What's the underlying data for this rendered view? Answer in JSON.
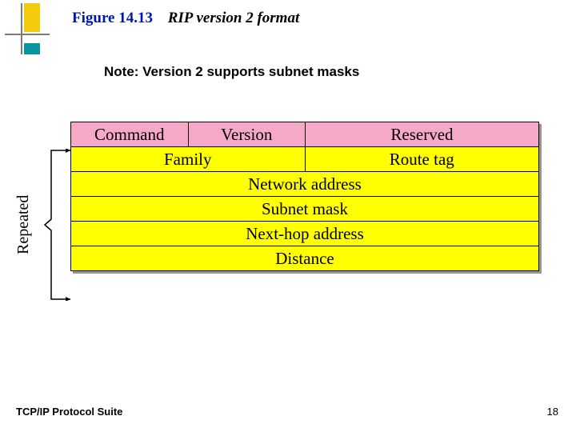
{
  "heading": {
    "figure_number": "Figure 14.13",
    "figure_title": "RIP version 2 format"
  },
  "note": "Note: Version 2 supports subnet masks",
  "repeated_label": "Repeated",
  "diagram": {
    "row1": {
      "c1": "Command",
      "c2": "Version",
      "c3": "Reserved"
    },
    "row2": {
      "c1": "Family",
      "c2": "Route tag"
    },
    "row3": "Network address",
    "row4": "Subnet mask",
    "row5": "Next-hop address",
    "row6": "Distance"
  },
  "footer": {
    "left": "TCP/IP Protocol Suite",
    "right": "18"
  }
}
